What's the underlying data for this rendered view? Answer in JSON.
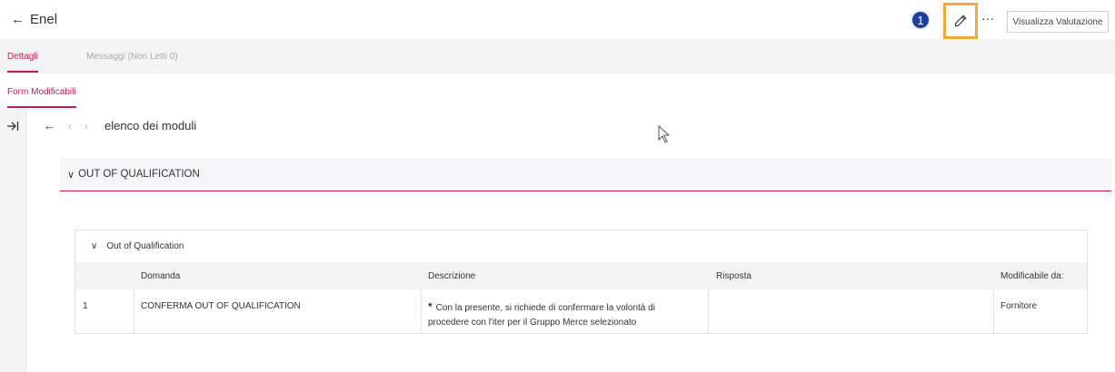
{
  "header": {
    "back_arrow": "←",
    "title": "Enel",
    "step_badge": "1",
    "edit_icon": "pencil-icon",
    "more_label": "···",
    "view_button": "Visualizza Valutazione",
    "highlight_color": "#f4a93a"
  },
  "tabs": [
    {
      "label": "Dettagli",
      "active": true
    },
    {
      "label": "Messaggi (Non Letti 0)",
      "active": false
    }
  ],
  "subtabs": [
    {
      "label": "Form Modificabili",
      "active": true
    }
  ],
  "nav": {
    "back_arrow": "←",
    "prev": "‹",
    "next": "›",
    "title": "elenco dei moduli"
  },
  "section": {
    "chevron": "∨",
    "title": "OUT OF QUALIFICATION"
  },
  "card": {
    "chevron": "∨",
    "title": "Out of Qualification",
    "columns": [
      "",
      "Domanda",
      "Descrizione",
      "Risposta",
      "Modificabile da:"
    ],
    "rows": [
      {
        "num": "1",
        "domanda": "CONFERMA OUT OF QUALIFICATION",
        "asterisk": "*",
        "descrizione_line1": "Con la presente, si richiede di confermare la volontà di",
        "descrizione_line2": "procedere con l'iter per il Gruppo Merce selezionato",
        "risposta": "",
        "modificabile": "Fornitore"
      }
    ]
  },
  "colors": {
    "accent": "#c2185b",
    "badge": "#1f3f9a"
  }
}
